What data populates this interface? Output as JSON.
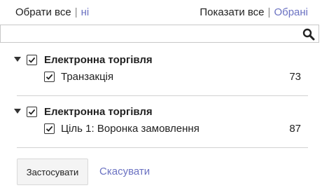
{
  "toolbar": {
    "select_all": "Обрати все",
    "separator": "|",
    "select_none": "ні",
    "show_all": "Показати все",
    "show_selected": "Обрані"
  },
  "search": {
    "value": "",
    "placeholder": "",
    "icon": "search-icon"
  },
  "groups": [
    {
      "label": "Електронна торгівля",
      "expanded": true,
      "checked": true,
      "items": [
        {
          "label": "Транзакція",
          "count": "73",
          "checked": true
        }
      ]
    },
    {
      "label": "Електронна торгівля",
      "expanded": true,
      "checked": true,
      "items": [
        {
          "label": "Ціль 1: Воронка замовлення",
          "count": "87",
          "checked": true
        }
      ]
    }
  ],
  "actions": {
    "apply_label": "Застосувати",
    "cancel_label": "Скасувати"
  },
  "colors": {
    "link": "#6b72c2",
    "text": "#212121",
    "divider": "#d2d2d2"
  }
}
